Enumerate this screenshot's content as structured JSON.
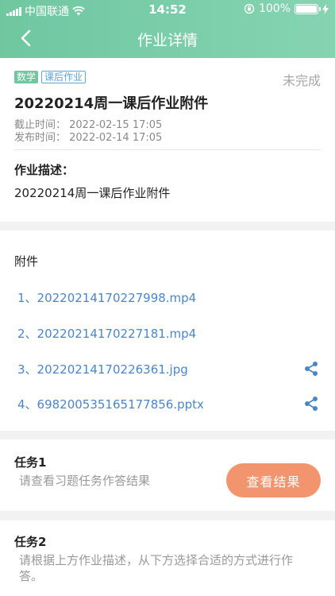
{
  "status_bar": {
    "carrier": "中国联通",
    "time": "14:52",
    "battery": "100%",
    "battery_level": 1.0
  },
  "nav": {
    "title": "作业详情",
    "back_icon": "chevron-left-icon"
  },
  "homework": {
    "tag_subject": "数学",
    "tag_type": "课后作业",
    "status": "未完成",
    "title": "20220214周一课后作业附件",
    "deadline": "截止时间：  2022-02-15 17:05",
    "published": "发布时间：  2022-02-14 17:05",
    "desc_label": "作业描述：",
    "desc": "20220214周一课后作业附件"
  },
  "attachments": {
    "label": "附件",
    "items": [
      {
        "name": "1、20220214170227998.mp4",
        "shareable": false
      },
      {
        "name": "2、20220214170227181.mp4",
        "shareable": false
      },
      {
        "name": "3、20220214170226361.jpg",
        "shareable": true
      },
      {
        "name": "4、698200535165177856.pptx",
        "shareable": true
      }
    ],
    "share_icon": "share-icon"
  },
  "tasks": [
    {
      "title": "任务1",
      "desc": "请查看习题任务作答结果",
      "button": "查看结果"
    },
    {
      "title": "任务2",
      "desc": "请根据上方作业描述，从下方选择合适的方式进行作答。"
    }
  ],
  "colors": {
    "header": "#6fc7a0",
    "accent_button": "#f2956f",
    "link": "#4a86c8"
  }
}
